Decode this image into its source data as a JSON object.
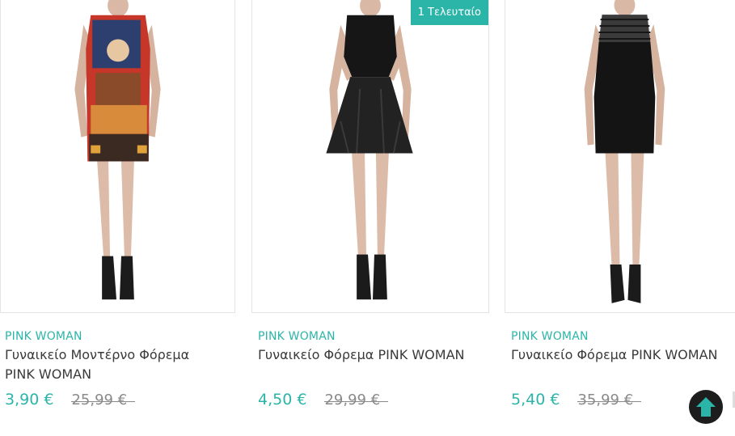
{
  "products": [
    {
      "brand": "PINK WOMAN",
      "name": "Γυναικείο Μοντέρνο Φόρεμα PINK WOMAN",
      "price": "3,90 €",
      "old_price": "25,99 €",
      "badge": ""
    },
    {
      "brand": "PINK WOMAN",
      "name": "Γυναικείο Φόρεμα PINK WOMAN",
      "price": "4,50 €",
      "old_price": "29,99 €",
      "badge": "1 Τελευταίο"
    },
    {
      "brand": "PINK WOMAN",
      "name": "Γυναικείο Φόρεμα PINK WOMAN",
      "price": "5,40 €",
      "old_price": "35,99 €",
      "badge": ""
    }
  ],
  "colors": {
    "accent": "#2bb5a9",
    "text": "#3a3a3a",
    "muted": "#8a8a8a",
    "scroll_button": "#1d1d1d"
  },
  "icons": {
    "scroll_top": "arrow-up-icon"
  }
}
